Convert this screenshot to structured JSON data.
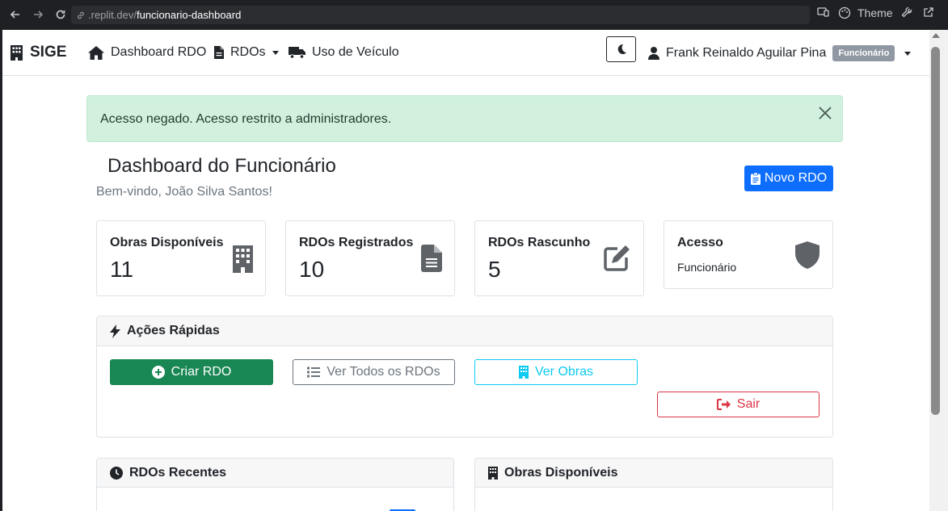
{
  "browser": {
    "url_prefix": ".replit.dev/",
    "url_path": "funcionario-dashboard",
    "theme_label": "Theme"
  },
  "navbar": {
    "brand": "SIGE",
    "items": [
      {
        "label": "Dashboard RDO",
        "icon": "home-icon"
      },
      {
        "label": "RDOs",
        "icon": "file-icon",
        "dropdown": true
      },
      {
        "label": "Uso de Veículo",
        "icon": "truck-icon"
      }
    ],
    "user_name": "Frank Reinaldo Aguilar Pina",
    "user_role": "Funcionário"
  },
  "alert": {
    "message": "Acesso negado. Acesso restrito a administradores."
  },
  "header": {
    "title": "Dashboard do Funcionário",
    "welcome": "Bem-vindo, João Silva Santos!",
    "new_button": "Novo RDO"
  },
  "stats": [
    {
      "label": "Obras Disponíveis",
      "value": "11",
      "icon": "building-icon"
    },
    {
      "label": "RDOs Registrados",
      "value": "10",
      "icon": "document-icon"
    },
    {
      "label": "RDOs Rascunho",
      "value": "5",
      "icon": "edit-icon"
    },
    {
      "label": "Acesso",
      "value": "Funcionário",
      "icon": "shield-icon"
    }
  ],
  "quick_actions": {
    "title": "Ações Rápidas",
    "buttons": {
      "criar": "Criar RDO",
      "ver_todos": "Ver Todos os RDOs",
      "ver_obras": "Ver Obras",
      "sair": "Sair"
    }
  },
  "panels": {
    "recent_rdos": "RDOs Recentes",
    "obras": "Obras Disponíveis"
  },
  "colors": {
    "primary": "#0d6efd",
    "success": "#198754",
    "info": "#0dcaf0",
    "danger": "#dc3545",
    "alert_bg": "#d1f1de"
  }
}
